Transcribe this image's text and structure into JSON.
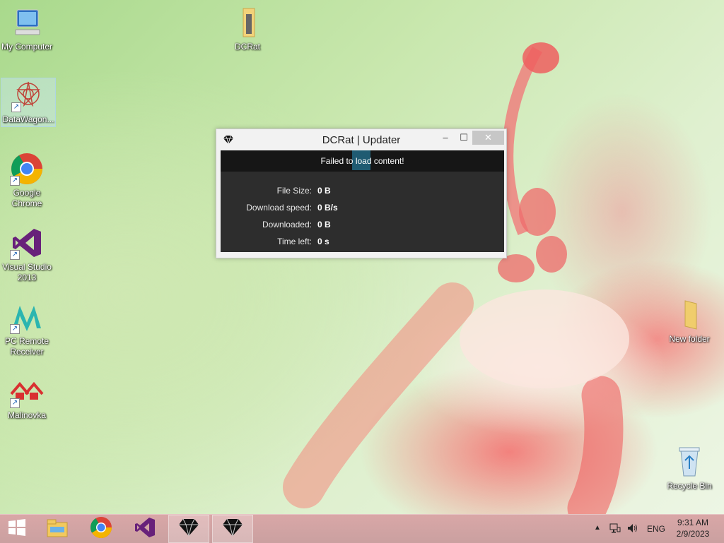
{
  "desktop": {
    "icons": [
      {
        "label": "My Computer",
        "icon": "computer-icon"
      },
      {
        "label": "DCRat",
        "icon": "folder-icon"
      },
      {
        "label": "DataWagon...",
        "icon": "datawagon-icon"
      },
      {
        "label": "Google Chrome",
        "icon": "chrome-icon"
      },
      {
        "label": "Visual Studio 2013",
        "icon": "visual-studio-icon"
      },
      {
        "label": "PC Remote Receiver",
        "icon": "pc-remote-icon"
      },
      {
        "label": "Malinovka",
        "icon": "malinovka-icon"
      },
      {
        "label": "New folder",
        "icon": "folder-icon"
      },
      {
        "label": "Recycle Bin",
        "icon": "recycle-bin-icon"
      }
    ]
  },
  "window": {
    "title": "DCRat | Updater",
    "minimize": "–",
    "maximize": "☐",
    "close": "✕",
    "banner": "Failed to load content!",
    "rows": [
      {
        "label": "File Size:",
        "value": "0 B"
      },
      {
        "label": "Download speed:",
        "value": "0 B/s"
      },
      {
        "label": "Downloaded:",
        "value": "0 B"
      },
      {
        "label": "Time left:",
        "value": "0 s"
      }
    ]
  },
  "taskbar": {
    "items": [
      "start-icon",
      "file-explorer-icon",
      "chrome-icon",
      "visual-studio-icon",
      "dcrat-icon",
      "dcrat-icon"
    ],
    "language": "ENG",
    "time": "9:31 AM",
    "date": "2/9/2023"
  },
  "colors": {
    "banner_bg": "#161616",
    "content_bg": "#2d2d2d",
    "taskbar_bg": "#caa0a0"
  }
}
